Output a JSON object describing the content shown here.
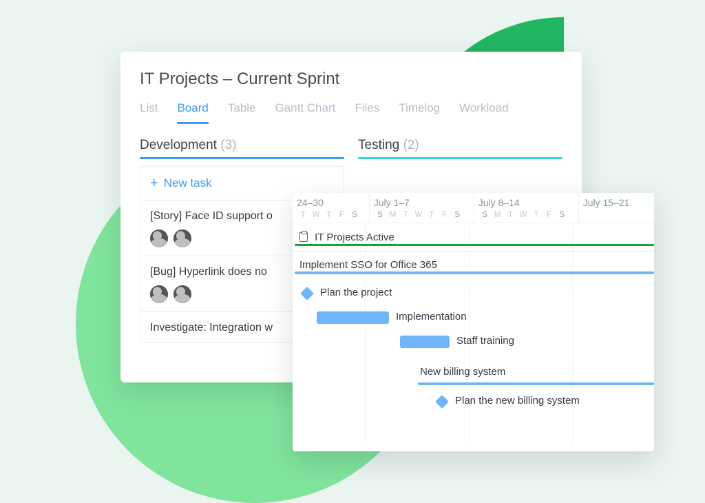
{
  "board": {
    "title": "IT Projects – Current Sprint",
    "tabs": [
      "List",
      "Board",
      "Table",
      "Gantt Chart",
      "Files",
      "Timelog",
      "Workload"
    ],
    "active_tab": "Board",
    "columns": {
      "dev": {
        "name": "Development",
        "count": "(3)"
      },
      "test": {
        "name": "Testing",
        "count": "(2)"
      }
    },
    "new_task_label": "New task",
    "tasks": {
      "t1": "[Story] Face ID support o",
      "t2": "[Bug] Hyperlink does no",
      "t3": "Investigate: Integration w"
    }
  },
  "gantt": {
    "weeks": [
      "24–30",
      "July 1–7",
      "July 8–14",
      "July 15–21"
    ],
    "days": [
      "S",
      "M",
      "T",
      "W",
      "T",
      "F",
      "S"
    ],
    "days_partial": [
      "T",
      "W",
      "T",
      "F",
      "S"
    ],
    "rows": {
      "project": "IT Projects Active",
      "sso": "Implement SSO for Office 365",
      "plan": "Plan the project",
      "impl": "Implementation",
      "staff": "Staff training",
      "billing": "New billing system",
      "plan_billing": "Plan the new billing system"
    }
  }
}
